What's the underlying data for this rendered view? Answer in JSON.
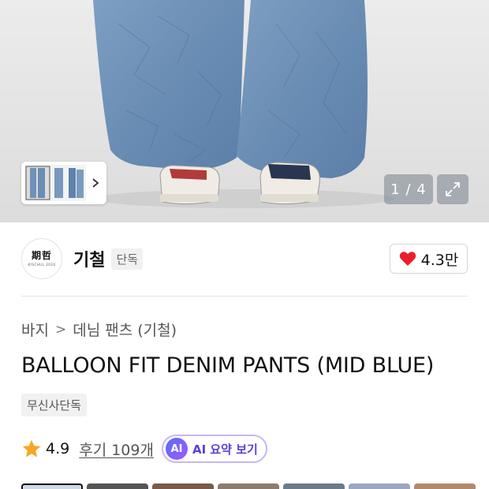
{
  "hero": {
    "counter": "1 / 4"
  },
  "brand": {
    "logo_text": "期哲",
    "logo_sub": "KISCHUL 2020",
    "name": "기철",
    "tag": "단독",
    "like_count": "4.3만"
  },
  "breadcrumb": {
    "category": "바지",
    "subcategory": "데님 팬츠 (기철)"
  },
  "product": {
    "title": "BALLOON FIT DENIM PANTS (MID BLUE)",
    "exclusive_badge": "무신사단독"
  },
  "rating": {
    "score": "4.9",
    "reviews": "후기 109개",
    "ai_badge": "AI",
    "ai_summary": "AI 요약 보기"
  },
  "colors": {
    "heart": "#e8202a",
    "star": "#f6a623",
    "ai_text": "#5a3fd9"
  },
  "options": [
    {
      "name": "option-1",
      "selected": true
    },
    {
      "name": "option-2",
      "selected": false
    },
    {
      "name": "option-3",
      "selected": false
    },
    {
      "name": "option-4",
      "selected": false
    },
    {
      "name": "option-5",
      "selected": false
    },
    {
      "name": "option-6",
      "selected": false
    },
    {
      "name": "option-7",
      "selected": false
    }
  ]
}
